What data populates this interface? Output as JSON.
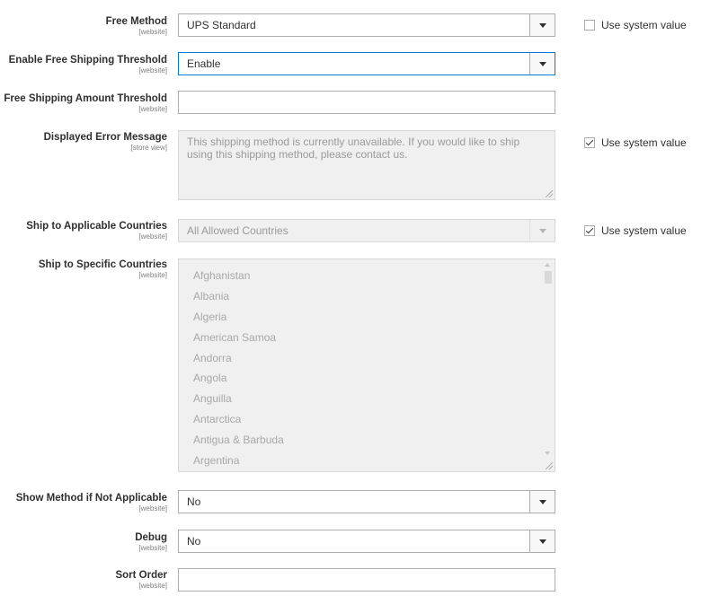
{
  "fields": {
    "free_method": {
      "label": "Free Method",
      "scope": "[website]",
      "value": "UPS Standard",
      "use_system_label": "Use system value",
      "use_system_checked": false
    },
    "enable_free_threshold": {
      "label": "Enable Free Shipping Threshold",
      "scope": "[website]",
      "value": "Enable"
    },
    "free_amount_threshold": {
      "label": "Free Shipping Amount Threshold",
      "scope": "[website]",
      "value": ""
    },
    "error_message": {
      "label": "Displayed Error Message",
      "scope": "[store view]",
      "value": "This shipping method is currently unavailable. If you would like to ship using this shipping method, please contact us.",
      "use_system_label": "Use system value",
      "use_system_checked": true
    },
    "applicable_countries": {
      "label": "Ship to Applicable Countries",
      "scope": "[website]",
      "value": "All Allowed Countries",
      "use_system_label": "Use system value",
      "use_system_checked": true
    },
    "specific_countries": {
      "label": "Ship to Specific Countries",
      "scope": "[website]",
      "options": [
        "Afghanistan",
        "Albania",
        "Algeria",
        "American Samoa",
        "Andorra",
        "Angola",
        "Anguilla",
        "Antarctica",
        "Antigua & Barbuda",
        "Argentina"
      ]
    },
    "show_method": {
      "label": "Show Method if Not Applicable",
      "scope": "[website]",
      "value": "No"
    },
    "debug": {
      "label": "Debug",
      "scope": "[website]",
      "value": "No"
    },
    "sort_order": {
      "label": "Sort Order",
      "scope": "[website]",
      "value": ""
    }
  },
  "colors": {
    "focus_border": "#007bdb",
    "disabled_bg": "#f0f0f0",
    "border": "#adadad"
  }
}
